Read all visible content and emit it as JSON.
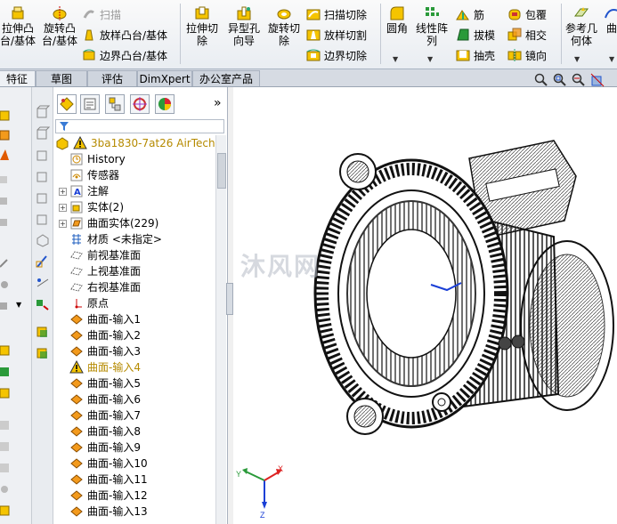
{
  "colors": {
    "accent": "#f5c400",
    "ribbon_bg": "#eef1f5",
    "warning": "#b58a00",
    "tree_icon_orange": "#f39a1c"
  },
  "ribbon": {
    "extrude_boss": "拉伸凸\n台/基体",
    "revolve_boss": "旋转凸\n台/基体",
    "sweep_boss": "扫描",
    "loft_boss": "放样凸台/基体",
    "boundary_boss": "边界凸台/基体",
    "extrude_cut": "拉伸切\n除",
    "hole_wizard": "异型孔\n向导",
    "revolve_cut": "旋转切\n除",
    "sweep_cut": "扫描切除",
    "loft_cut": "放样切割",
    "boundary_cut": "边界切除",
    "fillet": "圆角",
    "linear_pattern": "线性阵\n列",
    "rib": "筋",
    "draft": "拔模",
    "shell": "抽壳",
    "wrap": "包覆",
    "intersect": "相交",
    "mirror": "镜向",
    "ref_geometry": "参考几\n何体",
    "curves": "曲"
  },
  "tabs": [
    "特征",
    "草图",
    "评估",
    "DimXpert",
    "办公室产品"
  ],
  "tree": {
    "root": "3ba1830-7at26 AirTech",
    "items": [
      {
        "label": "History",
        "icon": "history-icon"
      },
      {
        "label": "传感器",
        "icon": "sensor-icon"
      },
      {
        "label": "注解",
        "icon": "annotation-icon",
        "expand": true
      },
      {
        "label": "实体(2)",
        "icon": "solid-bodies-icon",
        "expand": true
      },
      {
        "label": "曲面实体(229)",
        "icon": "surface-bodies-icon",
        "expand": true
      },
      {
        "label": "材质 <未指定>",
        "icon": "material-icon"
      },
      {
        "label": "前视基准面",
        "icon": "plane-icon"
      },
      {
        "label": "上视基准面",
        "icon": "plane-icon"
      },
      {
        "label": "右视基准面",
        "icon": "plane-icon"
      },
      {
        "label": "原点",
        "icon": "origin-icon"
      },
      {
        "label": "曲面-输入1",
        "icon": "surface-import-icon"
      },
      {
        "label": "曲面-输入2",
        "icon": "surface-import-icon"
      },
      {
        "label": "曲面-输入3",
        "icon": "surface-import-icon"
      },
      {
        "label": "曲面-输入4",
        "icon": "warning-icon",
        "warn": true
      },
      {
        "label": "曲面-输入5",
        "icon": "surface-import-icon"
      },
      {
        "label": "曲面-输入6",
        "icon": "surface-import-icon"
      },
      {
        "label": "曲面-输入7",
        "icon": "surface-import-icon"
      },
      {
        "label": "曲面-输入8",
        "icon": "surface-import-icon"
      },
      {
        "label": "曲面-输入9",
        "icon": "surface-import-icon"
      },
      {
        "label": "曲面-输入10",
        "icon": "surface-import-icon"
      },
      {
        "label": "曲面-输入11",
        "icon": "surface-import-icon"
      },
      {
        "label": "曲面-输入12",
        "icon": "surface-import-icon"
      },
      {
        "label": "曲面-输入13",
        "icon": "surface-import-icon"
      }
    ]
  },
  "triad": {
    "x": "X",
    "y": "Y",
    "z": "Z"
  },
  "watermark": "沐风网"
}
